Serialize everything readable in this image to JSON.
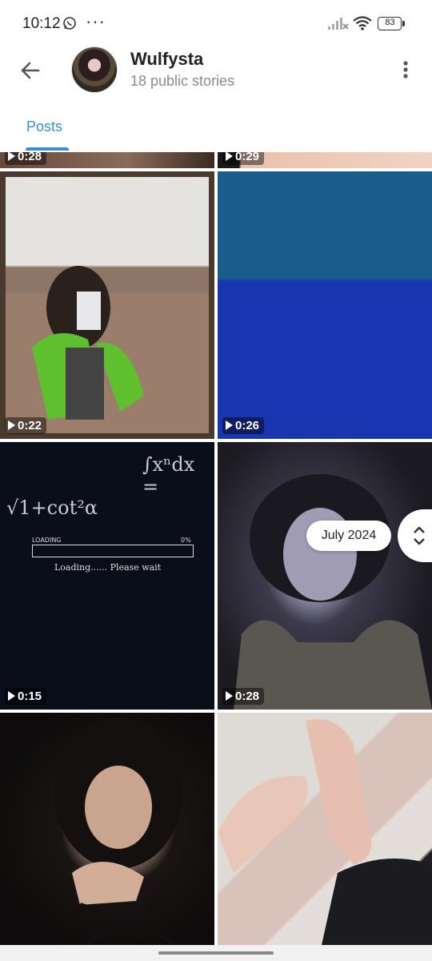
{
  "status_bar": {
    "time": "10:12",
    "menu_dots": "···",
    "battery": "83"
  },
  "header": {
    "title": "Wulfysta",
    "subtitle": "18 public stories"
  },
  "tabs": [
    {
      "label": "Posts",
      "active": true
    }
  ],
  "grid": {
    "items": [
      {
        "duration": "0:28"
      },
      {
        "duration": "0:29"
      },
      {
        "duration": "0:22"
      },
      {
        "duration": "0:26"
      },
      {
        "duration": "0:15"
      },
      {
        "duration": "0:28"
      },
      {
        "duration": ""
      },
      {
        "duration": ""
      }
    ],
    "chalkboard": {
      "formula_1": "∫xⁿdx =",
      "formula_2": "√1+cot²α",
      "loading_label": "LOADING",
      "loading_pct": "0%",
      "loading_text": "Loading...... Please wait"
    }
  },
  "date_chip": "July 2024",
  "colors": {
    "accent": "#3a8fd0"
  }
}
